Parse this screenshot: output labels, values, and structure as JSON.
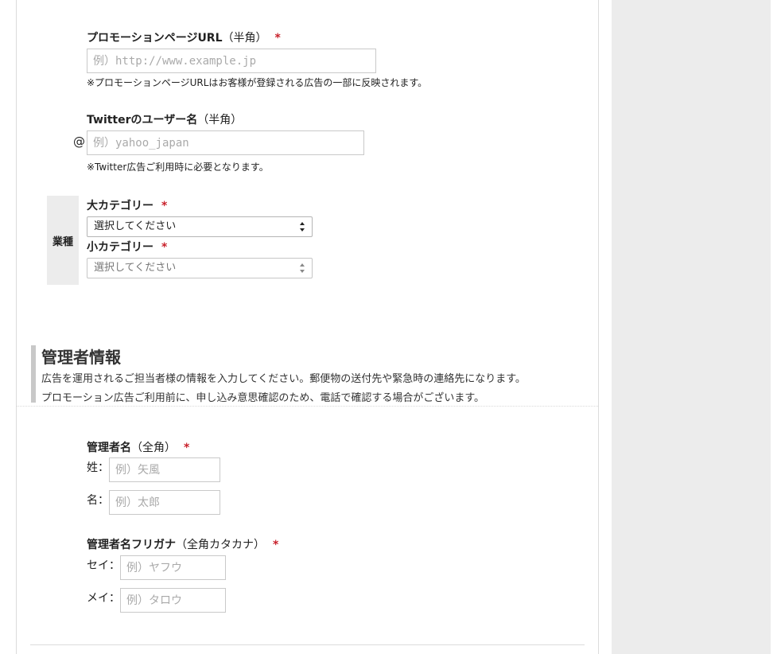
{
  "promo_url": {
    "label": "プロモーションページURL",
    "paren": "（半角）",
    "required_mark": "*",
    "placeholder": "例）http://www.example.jp",
    "note": "※プロモーションページURLはお客様が登録される広告の一部に反映されます。"
  },
  "twitter": {
    "label": "Twitterのユーザー名",
    "paren": "（半角）",
    "at_symbol": "@",
    "placeholder": "例）yahoo_japan",
    "note": "※Twitter広告ご利用時に必要となります。"
  },
  "industry": {
    "group_label": "業種",
    "large_category": {
      "label": "大カテゴリー",
      "required_mark": "*",
      "selected": "選択してください"
    },
    "small_category": {
      "label": "小カテゴリー",
      "required_mark": "*",
      "selected": "選択してください"
    }
  },
  "admin_section": {
    "title": "管理者情報",
    "desc_line1": "広告を運用されるご担当者様の情報を入力してください。郵便物の送付先や緊急時の連絡先になります。",
    "desc_line2": "プロモーション広告ご利用前に、申し込み意思確認のため、電話で確認する場合がございます。"
  },
  "admin_name": {
    "label": "管理者名",
    "paren": "（全角）",
    "required_mark": "*",
    "last_label": "姓：",
    "last_placeholder": "例）矢風",
    "first_label": "名：",
    "first_placeholder": "例）太郎"
  },
  "admin_kana": {
    "label": "管理者名フリガナ",
    "paren": "（全角カタカナ）",
    "required_mark": "*",
    "last_label": "セイ：",
    "last_placeholder": "例）ヤフウ",
    "first_label": "メイ：",
    "first_placeholder": "例）タロウ"
  },
  "colors": {
    "required": "#c8202a",
    "sidebar_bg": "#ececec",
    "section_bar": "#c8c8c8"
  }
}
